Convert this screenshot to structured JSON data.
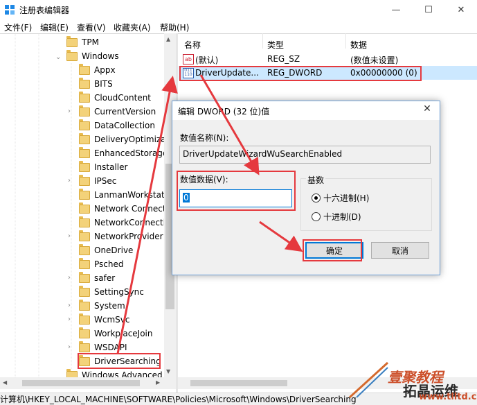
{
  "window": {
    "title": "注册表编辑器",
    "minimize": "—",
    "maximize": "☐",
    "close": "✕"
  },
  "menu": [
    "文件(F)",
    "编辑(E)",
    "查看(V)",
    "收藏夹(A)",
    "帮助(H)"
  ],
  "tree": {
    "parents": [
      "TPM",
      "Windows"
    ],
    "children": [
      "Appx",
      "BITS",
      "CloudContent",
      "CurrentVersion",
      "DataCollection",
      "DeliveryOptimizat",
      "EnhancedStorage",
      "Installer",
      "IPSec",
      "LanmanWorkstati",
      "Network Connect",
      "NetworkConnecti",
      "NetworkProvider",
      "OneDrive",
      "Psched",
      "safer",
      "SettingSync",
      "System",
      "WcmSvc",
      "WorkplaceJoin",
      "WSDAPI",
      "DriverSearching"
    ],
    "expandable": [
      false,
      false,
      false,
      true,
      false,
      false,
      false,
      false,
      true,
      false,
      false,
      false,
      true,
      false,
      false,
      true,
      false,
      true,
      true,
      false,
      true,
      false
    ],
    "last_partial": "Windows Advanced"
  },
  "list": {
    "headers": [
      "名称",
      "类型",
      "数据"
    ],
    "rows": [
      {
        "icon": "ab",
        "name": "(默认)",
        "type": "REG_SZ",
        "data": "(数值未设置)"
      },
      {
        "icon": "011\n110",
        "name": "DriverUpdate...",
        "type": "REG_DWORD",
        "data": "0x00000000 (0)"
      }
    ]
  },
  "dialog": {
    "title": "编辑 DWORD (32 位)值",
    "close": "✕",
    "name_label": "数值名称(N):",
    "name_value": "DriverUpdateWizardWuSearchEnabled",
    "data_label": "数值数据(V):",
    "data_value": "0",
    "base_label": "基数",
    "radio_hex": "十六进制(H)",
    "radio_dec": "十进制(D)",
    "ok": "确定",
    "cancel": "取消"
  },
  "status": "计算机\\HKEY_LOCAL_MACHINE\\SOFTWARE\\Policies\\Microsoft\\Windows\\DriverSearching",
  "watermark": {
    "line1": "壹聚教程",
    "line2": "拓晶运维",
    "line3": "www.tlltd.cn"
  },
  "colors": {
    "accent": "#0078d7",
    "selection": "#cce8ff",
    "annotation_red": "#e5393e",
    "folder": "#f3d27a"
  }
}
